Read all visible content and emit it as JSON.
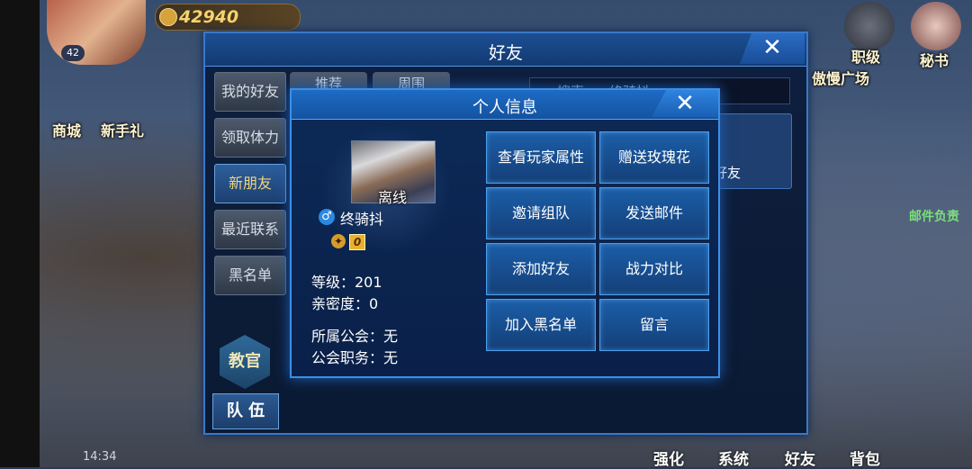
{
  "hud": {
    "player_level": "42",
    "gold": "42940",
    "top_right": [
      {
        "label": "职级"
      },
      {
        "label": "秘书"
      }
    ],
    "plaza_label": "傲慢广场",
    "left_shortcuts": [
      {
        "label": "商城"
      },
      {
        "label": "新手礼"
      }
    ],
    "mail_notice": "邮件负责",
    "bottom_nav": [
      {
        "label": "强化"
      },
      {
        "label": "系统"
      },
      {
        "label": "好友"
      },
      {
        "label": "背包"
      }
    ],
    "time": "14:34"
  },
  "friends_panel": {
    "title": "好友",
    "close_glyph": "✕",
    "side_tabs": [
      {
        "label": "我的好友"
      },
      {
        "label": "领取体力"
      },
      {
        "label": "新朋友"
      },
      {
        "label": "最近联系"
      },
      {
        "label": "黑名单"
      }
    ],
    "active_tab_index": 2,
    "top_tabs": [
      {
        "label": "推荐"
      },
      {
        "label": "周围"
      }
    ],
    "search": {
      "label": "搜索",
      "value": "终骑抖"
    },
    "card_label": "好友",
    "teach_label": "教官",
    "team_label": "队 伍"
  },
  "profile_modal": {
    "title": "个人信息",
    "close_glyph": "✕",
    "status": "离线",
    "gender_glyph": "♂",
    "player_name": "终骑抖",
    "rank_glyph": "0",
    "stats": [
      {
        "label": "等级：201"
      },
      {
        "label": "亲密度：0"
      },
      {
        "label": "所属公会：无"
      },
      {
        "label": "公会职务：无"
      }
    ],
    "actions": [
      {
        "label": "查看玩家属性"
      },
      {
        "label": "赠送玫瑰花"
      },
      {
        "label": "邀请组队"
      },
      {
        "label": "发送邮件"
      },
      {
        "label": "添加好友"
      },
      {
        "label": "战力对比"
      },
      {
        "label": "加入黑名单"
      },
      {
        "label": "留言"
      }
    ]
  },
  "colors": {
    "panel_border": "#3c8fe6",
    "button_blue": "#1b5ea8",
    "active_tab_text": "#f0d67c"
  }
}
